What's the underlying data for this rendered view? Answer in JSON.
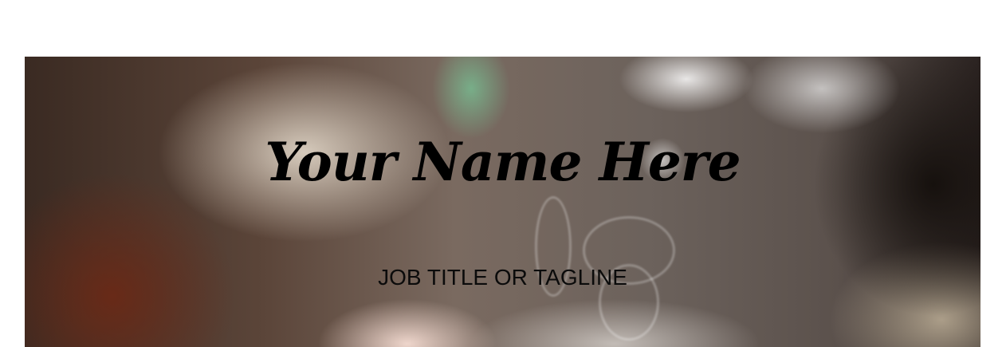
{
  "hero": {
    "name": "Your Name Here",
    "tagline": "JOB TITLE OR TAGLINE"
  },
  "colors": {
    "page_background": "#ffffff",
    "name_text": "#000000",
    "tagline_text": "#0b0b0b"
  }
}
